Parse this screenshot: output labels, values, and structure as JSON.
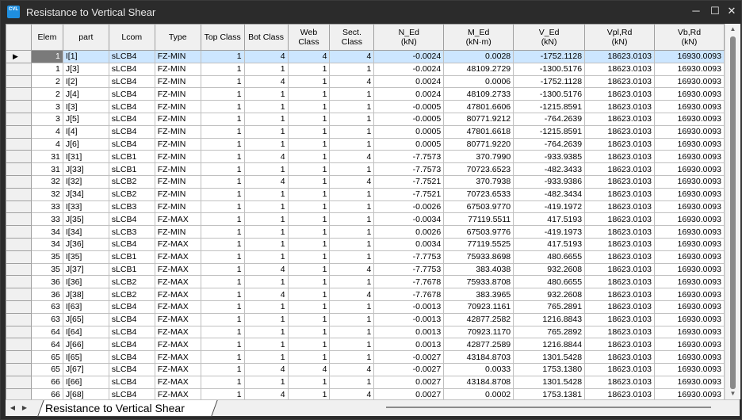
{
  "window": {
    "title": "Resistance to Vertical Shear",
    "icon_label": "CVL",
    "minimize_symbol": "─",
    "maximize_symbol": "☐",
    "close_symbol": "✕"
  },
  "columns": [
    "Elem",
    "part",
    "Lcom",
    "Type",
    "Top Class",
    "Bot Class",
    "Web Class",
    "Sect.\nClass",
    "N_Ed\n(kN)",
    "M_Ed\n(kN·m)",
    "V_Ed\n(kN)",
    "Vpl,Rd\n(kN)",
    "Vb,Rd\n(kN)"
  ],
  "selected_row_marker": "▶",
  "rows": [
    [
      "1",
      "I[1]",
      "sLCB4",
      "FZ-MIN",
      "1",
      "4",
      "4",
      "4",
      "-0.0024",
      "0.0028",
      "-1752.1128",
      "18623.0103",
      "16930.0093"
    ],
    [
      "1",
      "J[3]",
      "sLCB4",
      "FZ-MIN",
      "1",
      "1",
      "1",
      "1",
      "-0.0024",
      "48109.2729",
      "-1300.5176",
      "18623.0103",
      "16930.0093"
    ],
    [
      "2",
      "I[2]",
      "sLCB4",
      "FZ-MIN",
      "1",
      "4",
      "1",
      "4",
      "0.0024",
      "0.0006",
      "-1752.1128",
      "18623.0103",
      "16930.0093"
    ],
    [
      "2",
      "J[4]",
      "sLCB4",
      "FZ-MIN",
      "1",
      "1",
      "1",
      "1",
      "0.0024",
      "48109.2733",
      "-1300.5176",
      "18623.0103",
      "16930.0093"
    ],
    [
      "3",
      "I[3]",
      "sLCB4",
      "FZ-MIN",
      "1",
      "1",
      "1",
      "1",
      "-0.0005",
      "47801.6606",
      "-1215.8591",
      "18623.0103",
      "16930.0093"
    ],
    [
      "3",
      "J[5]",
      "sLCB4",
      "FZ-MIN",
      "1",
      "1",
      "1",
      "1",
      "-0.0005",
      "80771.9212",
      "-764.2639",
      "18623.0103",
      "16930.0093"
    ],
    [
      "4",
      "I[4]",
      "sLCB4",
      "FZ-MIN",
      "1",
      "1",
      "1",
      "1",
      "0.0005",
      "47801.6618",
      "-1215.8591",
      "18623.0103",
      "16930.0093"
    ],
    [
      "4",
      "J[6]",
      "sLCB4",
      "FZ-MIN",
      "1",
      "1",
      "1",
      "1",
      "0.0005",
      "80771.9220",
      "-764.2639",
      "18623.0103",
      "16930.0093"
    ],
    [
      "31",
      "I[31]",
      "sLCB1",
      "FZ-MIN",
      "1",
      "4",
      "1",
      "4",
      "-7.7573",
      "370.7990",
      "-933.9385",
      "18623.0103",
      "16930.0093"
    ],
    [
      "31",
      "J[33]",
      "sLCB1",
      "FZ-MIN",
      "1",
      "1",
      "1",
      "1",
      "-7.7573",
      "70723.6523",
      "-482.3433",
      "18623.0103",
      "16930.0093"
    ],
    [
      "32",
      "I[32]",
      "sLCB2",
      "FZ-MIN",
      "1",
      "4",
      "1",
      "4",
      "-7.7521",
      "370.7938",
      "-933.9386",
      "18623.0103",
      "16930.0093"
    ],
    [
      "32",
      "J[34]",
      "sLCB2",
      "FZ-MIN",
      "1",
      "1",
      "1",
      "1",
      "-7.7521",
      "70723.6533",
      "-482.3434",
      "18623.0103",
      "16930.0093"
    ],
    [
      "33",
      "I[33]",
      "sLCB3",
      "FZ-MIN",
      "1",
      "1",
      "1",
      "1",
      "-0.0026",
      "67503.9770",
      "-419.1972",
      "18623.0103",
      "16930.0093"
    ],
    [
      "33",
      "J[35]",
      "sLCB4",
      "FZ-MAX",
      "1",
      "1",
      "1",
      "1",
      "-0.0034",
      "77119.5511",
      "417.5193",
      "18623.0103",
      "16930.0093"
    ],
    [
      "34",
      "I[34]",
      "sLCB3",
      "FZ-MIN",
      "1",
      "1",
      "1",
      "1",
      "0.0026",
      "67503.9776",
      "-419.1973",
      "18623.0103",
      "16930.0093"
    ],
    [
      "34",
      "J[36]",
      "sLCB4",
      "FZ-MAX",
      "1",
      "1",
      "1",
      "1",
      "0.0034",
      "77119.5525",
      "417.5193",
      "18623.0103",
      "16930.0093"
    ],
    [
      "35",
      "I[35]",
      "sLCB1",
      "FZ-MAX",
      "1",
      "1",
      "1",
      "1",
      "-7.7753",
      "75933.8698",
      "480.6655",
      "18623.0103",
      "16930.0093"
    ],
    [
      "35",
      "J[37]",
      "sLCB1",
      "FZ-MAX",
      "1",
      "4",
      "1",
      "4",
      "-7.7753",
      "383.4038",
      "932.2608",
      "18623.0103",
      "16930.0093"
    ],
    [
      "36",
      "I[36]",
      "sLCB2",
      "FZ-MAX",
      "1",
      "1",
      "1",
      "1",
      "-7.7678",
      "75933.8708",
      "480.6655",
      "18623.0103",
      "16930.0093"
    ],
    [
      "36",
      "J[38]",
      "sLCB2",
      "FZ-MAX",
      "1",
      "4",
      "1",
      "4",
      "-7.7678",
      "383.3965",
      "932.2608",
      "18623.0103",
      "16930.0093"
    ],
    [
      "63",
      "I[63]",
      "sLCB4",
      "FZ-MAX",
      "1",
      "1",
      "1",
      "1",
      "-0.0013",
      "70923.1161",
      "765.2891",
      "18623.0103",
      "16930.0093"
    ],
    [
      "63",
      "J[65]",
      "sLCB4",
      "FZ-MAX",
      "1",
      "1",
      "1",
      "1",
      "-0.0013",
      "42877.2582",
      "1216.8843",
      "18623.0103",
      "16930.0093"
    ],
    [
      "64",
      "I[64]",
      "sLCB4",
      "FZ-MAX",
      "1",
      "1",
      "1",
      "1",
      "0.0013",
      "70923.1170",
      "765.2892",
      "18623.0103",
      "16930.0093"
    ],
    [
      "64",
      "J[66]",
      "sLCB4",
      "FZ-MAX",
      "1",
      "1",
      "1",
      "1",
      "0.0013",
      "42877.2589",
      "1216.8844",
      "18623.0103",
      "16930.0093"
    ],
    [
      "65",
      "I[65]",
      "sLCB4",
      "FZ-MAX",
      "1",
      "1",
      "1",
      "1",
      "-0.0027",
      "43184.8703",
      "1301.5428",
      "18623.0103",
      "16930.0093"
    ],
    [
      "65",
      "J[67]",
      "sLCB4",
      "FZ-MAX",
      "1",
      "4",
      "4",
      "4",
      "-0.0027",
      "0.0033",
      "1753.1380",
      "18623.0103",
      "16930.0093"
    ],
    [
      "66",
      "I[66]",
      "sLCB4",
      "FZ-MAX",
      "1",
      "1",
      "1",
      "1",
      "0.0027",
      "43184.8708",
      "1301.5428",
      "18623.0103",
      "16930.0093"
    ],
    [
      "66",
      "J[68]",
      "sLCB4",
      "FZ-MAX",
      "1",
      "4",
      "1",
      "4",
      "0.0027",
      "0.0002",
      "1753.1381",
      "18623.0103",
      "16930.0093"
    ]
  ],
  "sheet_tab": {
    "label": "Resistance to Vertical Shear"
  },
  "nav": {
    "prev": "◀",
    "next": "▶"
  },
  "scrollbar": {
    "up": "▲",
    "down": "▼"
  },
  "colors": {
    "selected_row": "#cce6ff",
    "selected_cell": "#7a7a7a",
    "header_bg": "#f0f0f0",
    "title_bar": "#2b2b2b",
    "app_icon": "#1f8fe0"
  }
}
